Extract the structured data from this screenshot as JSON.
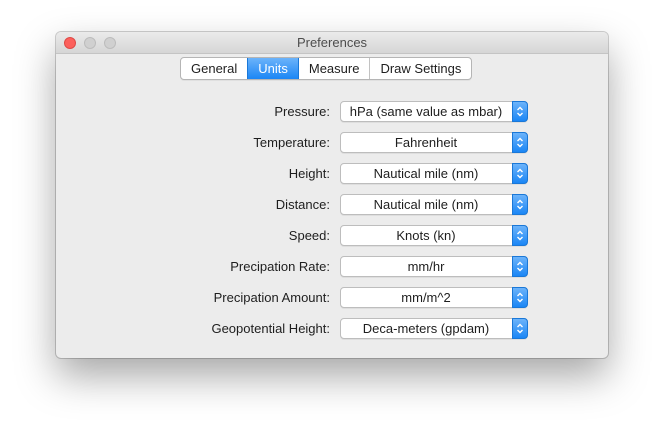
{
  "window": {
    "title": "Preferences"
  },
  "tabs": [
    {
      "label": "General",
      "active": false
    },
    {
      "label": "Units",
      "active": true
    },
    {
      "label": "Measure",
      "active": false
    },
    {
      "label": "Draw Settings",
      "active": false
    }
  ],
  "settings": [
    {
      "label": "Pressure:",
      "value": "hPa (same value as mbar)"
    },
    {
      "label": "Temperature:",
      "value": "Fahrenheit"
    },
    {
      "label": "Height:",
      "value": "Nautical mile (nm)"
    },
    {
      "label": "Distance:",
      "value": "Nautical mile (nm)"
    },
    {
      "label": "Speed:",
      "value": "Knots (kn)"
    },
    {
      "label": "Precipation Rate:",
      "value": "mm/hr"
    },
    {
      "label": "Precipation Amount:",
      "value": "mm/m^2"
    },
    {
      "label": "Geopotential Height:",
      "value": "Deca-meters (gpdam)"
    }
  ],
  "icons": {
    "close": "close-icon",
    "minimize": "minimize-icon",
    "zoom": "zoom-icon",
    "popup_arrows": "chevron-up-down-icon"
  },
  "colors": {
    "accent": "#1b86f5",
    "close": "#fc605c",
    "window_bg": "#ececec"
  }
}
